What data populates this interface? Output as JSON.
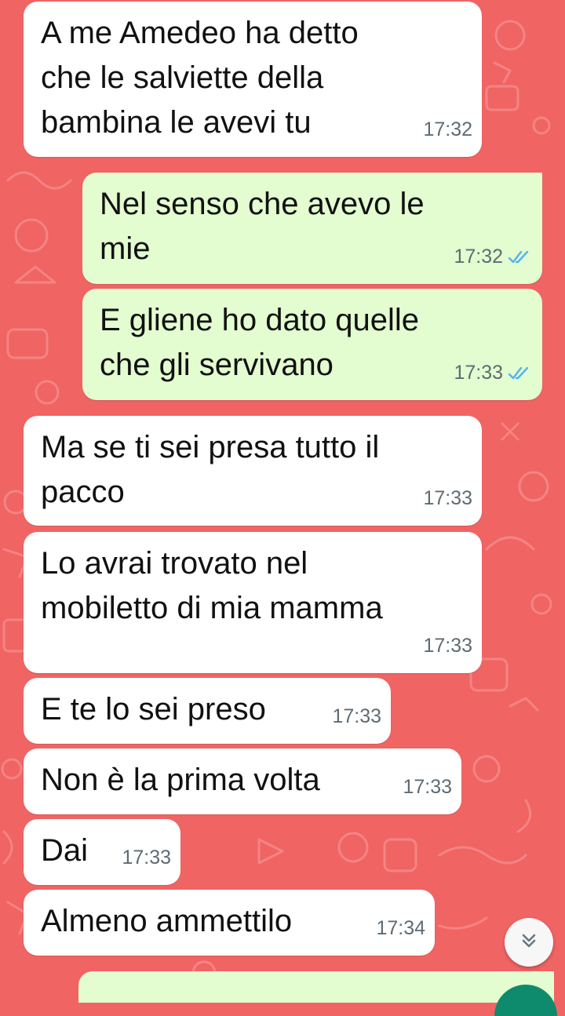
{
  "chat": {
    "messages": [
      {
        "direction": "in",
        "text": "A me Amedeo ha detto\nche le salviette della\nbambina le avevi tu",
        "time": "17:32"
      },
      {
        "direction": "out",
        "text": "Nel senso che avevo le\nmie",
        "time": "17:32",
        "status": "read"
      },
      {
        "direction": "out",
        "text": "E gliene ho dato quelle\nche gli servivano",
        "time": "17:33",
        "status": "read"
      },
      {
        "direction": "in",
        "text": "Ma se ti sei presa tutto il\npacco",
        "time": "17:33"
      },
      {
        "direction": "in",
        "text": "Lo avrai trovato nel\nmobiletto di mia mamma",
        "time": "17:33"
      },
      {
        "direction": "in",
        "text": "E te lo sei preso",
        "time": "17:33"
      },
      {
        "direction": "in",
        "text": "Non è la prima volta",
        "time": "17:33"
      },
      {
        "direction": "in",
        "text": "Dai",
        "time": "17:33"
      },
      {
        "direction": "in",
        "text": "Almeno ammettilo",
        "time": "17:34"
      }
    ]
  },
  "colors": {
    "wallpaper": "#f06464",
    "incoming_bubble": "#ffffff",
    "outgoing_bubble": "#e3fcd0",
    "read_ticks": "#4fb6ec"
  },
  "icons": {
    "read_status": "double-check-icon",
    "scroll": "double-chevron-down-icon"
  }
}
